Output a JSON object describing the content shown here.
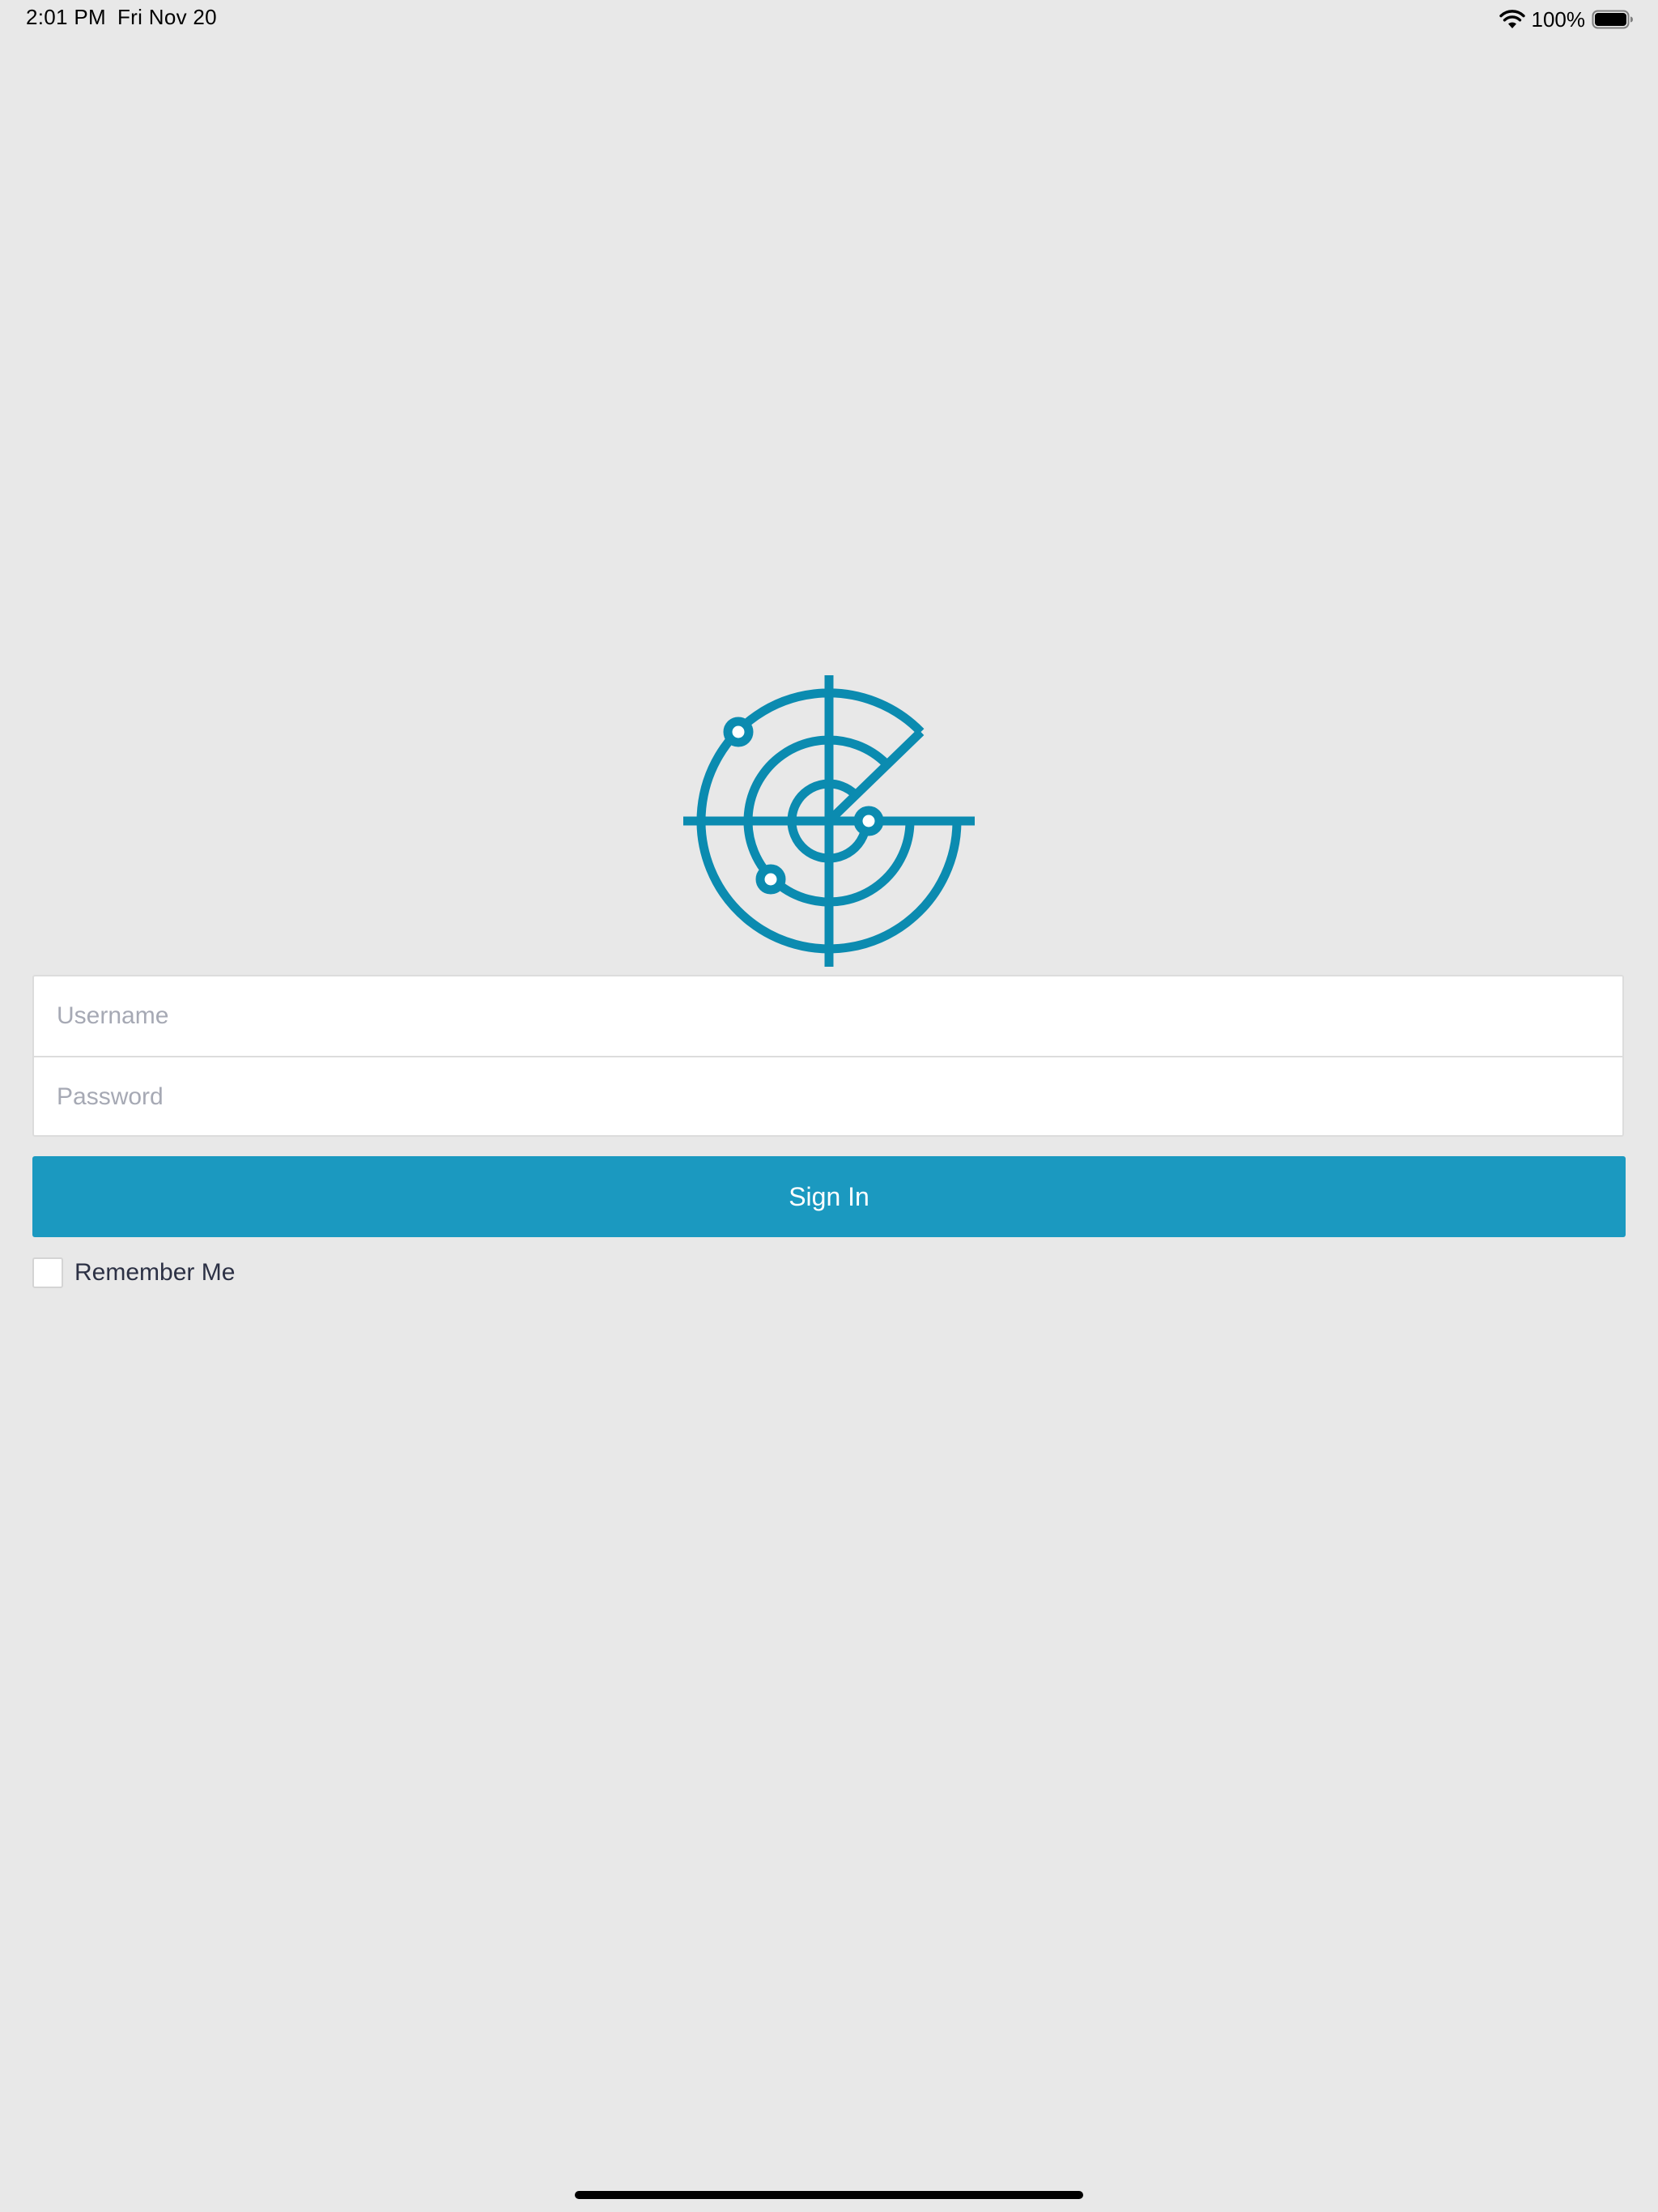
{
  "status_bar": {
    "time": "2:01 PM",
    "date": "Fri Nov 20",
    "battery_percent": "100%",
    "wifi_icon": "wifi-icon",
    "battery_icon": "battery-icon"
  },
  "logo": {
    "icon": "radar-icon",
    "color": "#0b8bb0"
  },
  "login": {
    "username_placeholder": "Username",
    "username_value": "",
    "password_placeholder": "Password",
    "password_value": "",
    "sign_in_label": "Sign In",
    "remember_me_label": "Remember Me",
    "remember_me_checked": false
  },
  "colors": {
    "background": "#e8e8e8",
    "primary_button": "#1b99c0",
    "logo": "#0b8bb0",
    "placeholder": "#a6a9b4"
  }
}
